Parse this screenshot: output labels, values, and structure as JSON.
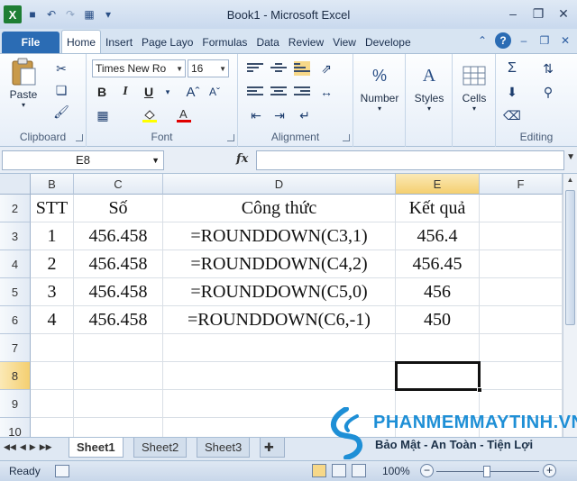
{
  "window": {
    "title": "Book1  -  Microsoft Excel",
    "app_letter": "X"
  },
  "tabs": [
    {
      "label": "File"
    },
    {
      "label": "Home"
    },
    {
      "label": "Insert"
    },
    {
      "label": "Page Layo"
    },
    {
      "label": "Formulas"
    },
    {
      "label": "Data"
    },
    {
      "label": "Review"
    },
    {
      "label": "View"
    },
    {
      "label": "Develope"
    }
  ],
  "ribbon": {
    "clipboard": {
      "label": "Clipboard",
      "paste_label": "Paste"
    },
    "font": {
      "label": "Font",
      "font_name": "Times New Ro",
      "font_size": "16",
      "bold": "B",
      "italic": "I",
      "underline": "U"
    },
    "alignment": {
      "label": "Alignment"
    },
    "number": {
      "label": "Number",
      "icon_text": "%"
    },
    "styles": {
      "label": "Styles",
      "icon_text": "A"
    },
    "cells": {
      "label": "Cells"
    },
    "editing": {
      "label": "Editing",
      "sum_symbol": "Σ"
    }
  },
  "formula_bar": {
    "name_box": "E8",
    "fx": "fx",
    "formula": ""
  },
  "grid": {
    "columns": [
      {
        "label": "B",
        "selected": false
      },
      {
        "label": "C",
        "selected": false
      },
      {
        "label": "D",
        "selected": false
      },
      {
        "label": "E",
        "selected": true
      },
      {
        "label": "F",
        "selected": false
      }
    ],
    "rows": [
      {
        "num": "2",
        "selected": false,
        "cells": [
          "STT",
          "Số",
          "Công thức",
          "Kết quả",
          ""
        ]
      },
      {
        "num": "3",
        "selected": false,
        "cells": [
          "1",
          "456.458",
          "=ROUNDDOWN(C3,1)",
          "456.4",
          ""
        ]
      },
      {
        "num": "4",
        "selected": false,
        "cells": [
          "2",
          "456.458",
          "=ROUNDDOWN(C4,2)",
          "456.45",
          ""
        ]
      },
      {
        "num": "5",
        "selected": false,
        "cells": [
          "3",
          "456.458",
          "=ROUNDDOWN(C5,0)",
          "456",
          ""
        ]
      },
      {
        "num": "6",
        "selected": false,
        "cells": [
          "4",
          "456.458",
          "=ROUNDDOWN(C6,-1)",
          "450",
          ""
        ]
      },
      {
        "num": "7",
        "selected": false,
        "cells": [
          "",
          "",
          "",
          "",
          ""
        ]
      },
      {
        "num": "8",
        "selected": true,
        "cells": [
          "",
          "",
          "",
          "",
          ""
        ]
      },
      {
        "num": "9",
        "selected": false,
        "cells": [
          "",
          "",
          "",
          "",
          ""
        ]
      },
      {
        "num": "10",
        "selected": false,
        "cells": [
          "",
          "",
          "",
          "",
          ""
        ]
      }
    ]
  },
  "sheets": [
    {
      "label": "Sheet1",
      "active": true
    },
    {
      "label": "Sheet2",
      "active": false
    },
    {
      "label": "Sheet3",
      "active": false
    }
  ],
  "status": {
    "ready": "Ready",
    "zoom": "100%"
  },
  "watermark": {
    "title": "PHANMEMMAYTINH.VN",
    "subtitle": "Bảo Mật - An Toàn - Tiện Lợi"
  }
}
